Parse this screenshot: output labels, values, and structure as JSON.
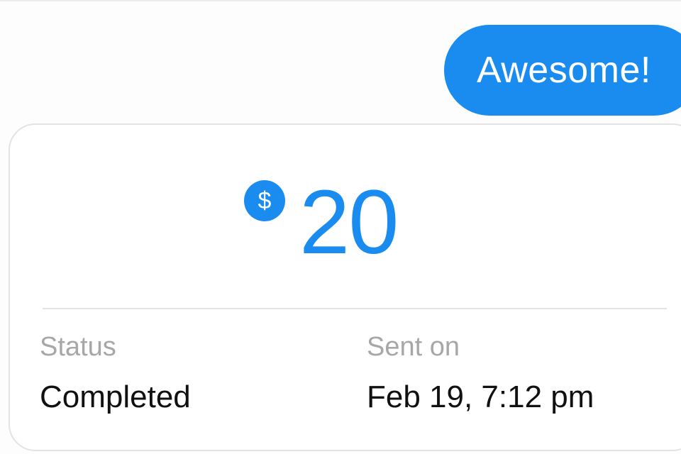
{
  "message": {
    "text": "Awesome!",
    "bubble_color": "#1A8CF0"
  },
  "payment": {
    "currency_icon": "dollar-sign-icon",
    "currency_symbol": "$",
    "amount": "20",
    "accent_color": "#1A8CF0",
    "status_label": "Status",
    "status_value": "Completed",
    "sent_label": "Sent on",
    "sent_value": "Feb 19, 7:12 pm"
  }
}
